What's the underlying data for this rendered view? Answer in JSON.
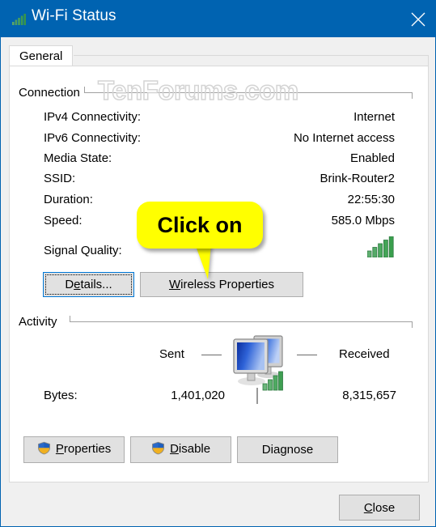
{
  "window": {
    "title": "Wi-Fi Status",
    "title_icon": "wifi-signal-icon",
    "close_icon": "close-icon",
    "accent_color": "#0063b1"
  },
  "tabs": [
    {
      "label": "General",
      "selected": true
    }
  ],
  "watermark": "TenForums.com",
  "connection": {
    "group_label": "Connection",
    "rows": [
      {
        "label": "IPv4 Connectivity:",
        "value": "Internet"
      },
      {
        "label": "IPv6 Connectivity:",
        "value": "No Internet access"
      },
      {
        "label": "Media State:",
        "value": "Enabled"
      },
      {
        "label": "SSID:",
        "value": "Brink-Router2"
      },
      {
        "label": "Duration:",
        "value": "22:55:30"
      },
      {
        "label": "Speed:",
        "value": "585.0 Mbps"
      },
      {
        "label": "Signal Quality:",
        "value": "",
        "icon": "signal-bars-icon"
      }
    ],
    "buttons": [
      {
        "label": "Details...",
        "accel": "e",
        "focused": true
      },
      {
        "label": "Wireless Properties",
        "accel": "W",
        "focused": false
      }
    ]
  },
  "callout": {
    "text": "Click on",
    "background": "#ffff00",
    "points_at": "Wireless Properties"
  },
  "activity": {
    "group_label": "Activity",
    "sent_label": "Sent",
    "received_label": "Received",
    "icon": "two-computers-network-icon",
    "bytes_label": "Bytes:",
    "bytes_sent": "1,401,020",
    "bytes_received": "8,315,657"
  },
  "action_buttons": [
    {
      "label": "Properties",
      "accel": "P",
      "icon": "uac-shield-icon"
    },
    {
      "label": "Disable",
      "accel": "D",
      "icon": "uac-shield-icon"
    },
    {
      "label": "Diagnose",
      "accel": "g",
      "icon": null
    }
  ],
  "footer": {
    "close_label": "Close",
    "close_accel": "C"
  }
}
